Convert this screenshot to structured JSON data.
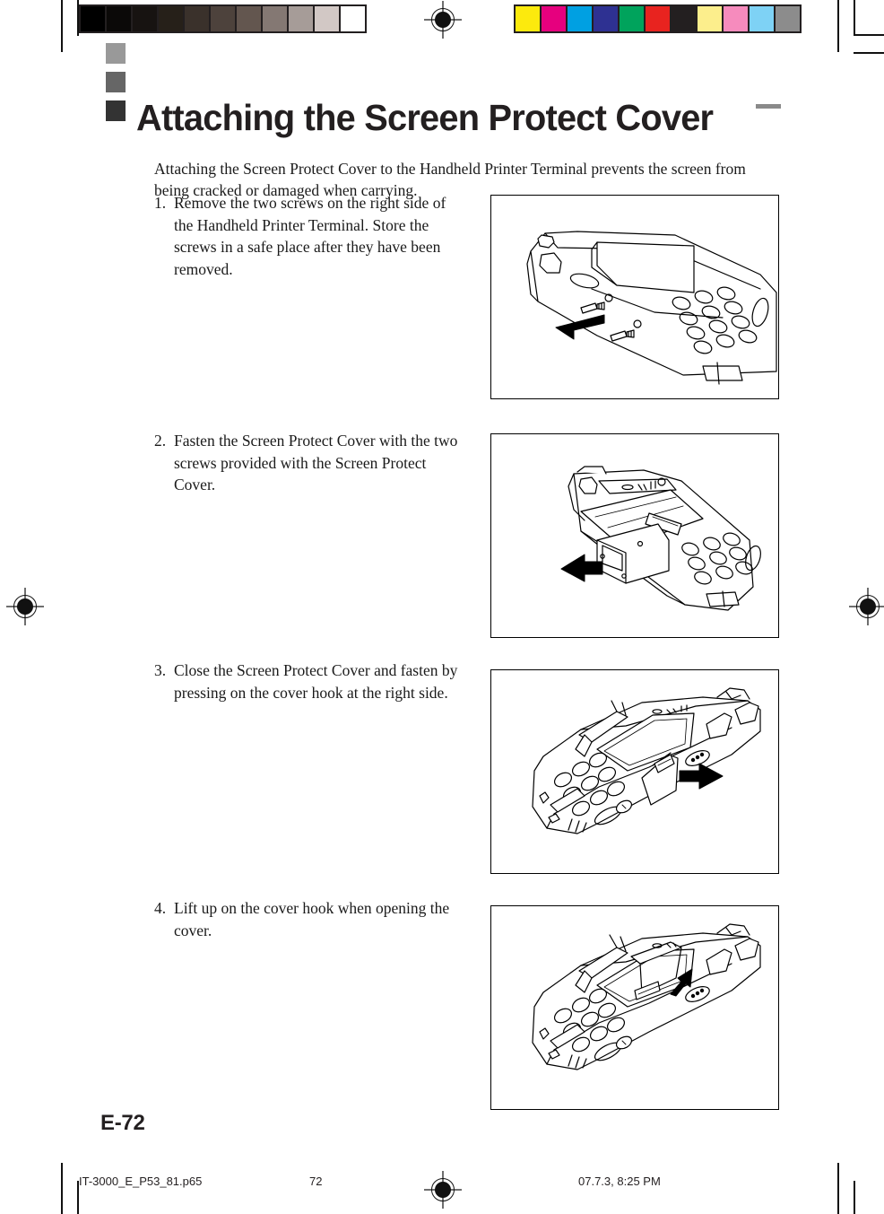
{
  "document": {
    "heading": "Attaching the Screen Protect Cover",
    "intro": "Attaching the Screen Protect Cover to the Handheld Printer Terminal prevents the screen from being cracked or damaged when carrying.",
    "page_folio": "E-72"
  },
  "steps": [
    {
      "number": "1.",
      "text": "Remove the two screws on the right side of the Handheld Printer Terminal.  Store the screws in a safe place after they have been removed.",
      "figure_name": "figure-remove-screws"
    },
    {
      "number": "2.",
      "text": "Fasten the Screen Protect Cover with the two screws provided with the Screen Protect Cover.",
      "figure_name": "figure-fasten-cover"
    },
    {
      "number": "3.",
      "text": "Close the Screen Protect Cover and fasten by pressing on the cover hook at the right side.",
      "figure_name": "figure-close-cover"
    },
    {
      "number": "4.",
      "text": "Lift up on the cover hook when opening the cover.",
      "figure_name": "figure-open-cover"
    }
  ],
  "footer": {
    "file_name": "IT-3000_E_P53_81.p65",
    "page_number": "72",
    "timestamp": "07.7.3, 8:25 PM"
  },
  "calibration": {
    "grayscale": [
      "#000000",
      "#0b0908",
      "#171311",
      "#262019",
      "#3a312b",
      "#4d423c",
      "#63564f",
      "#847873",
      "#a69c98",
      "#d2c8c5",
      "#ffffff"
    ],
    "colors": [
      "#fcea0d",
      "#e6007e",
      "#00a0e2",
      "#2e3192",
      "#00a35c",
      "#e8231f",
      "#231f20",
      "#fcee8c",
      "#f68bbd",
      "#7ed2f5",
      "#8c8c8c"
    ]
  }
}
